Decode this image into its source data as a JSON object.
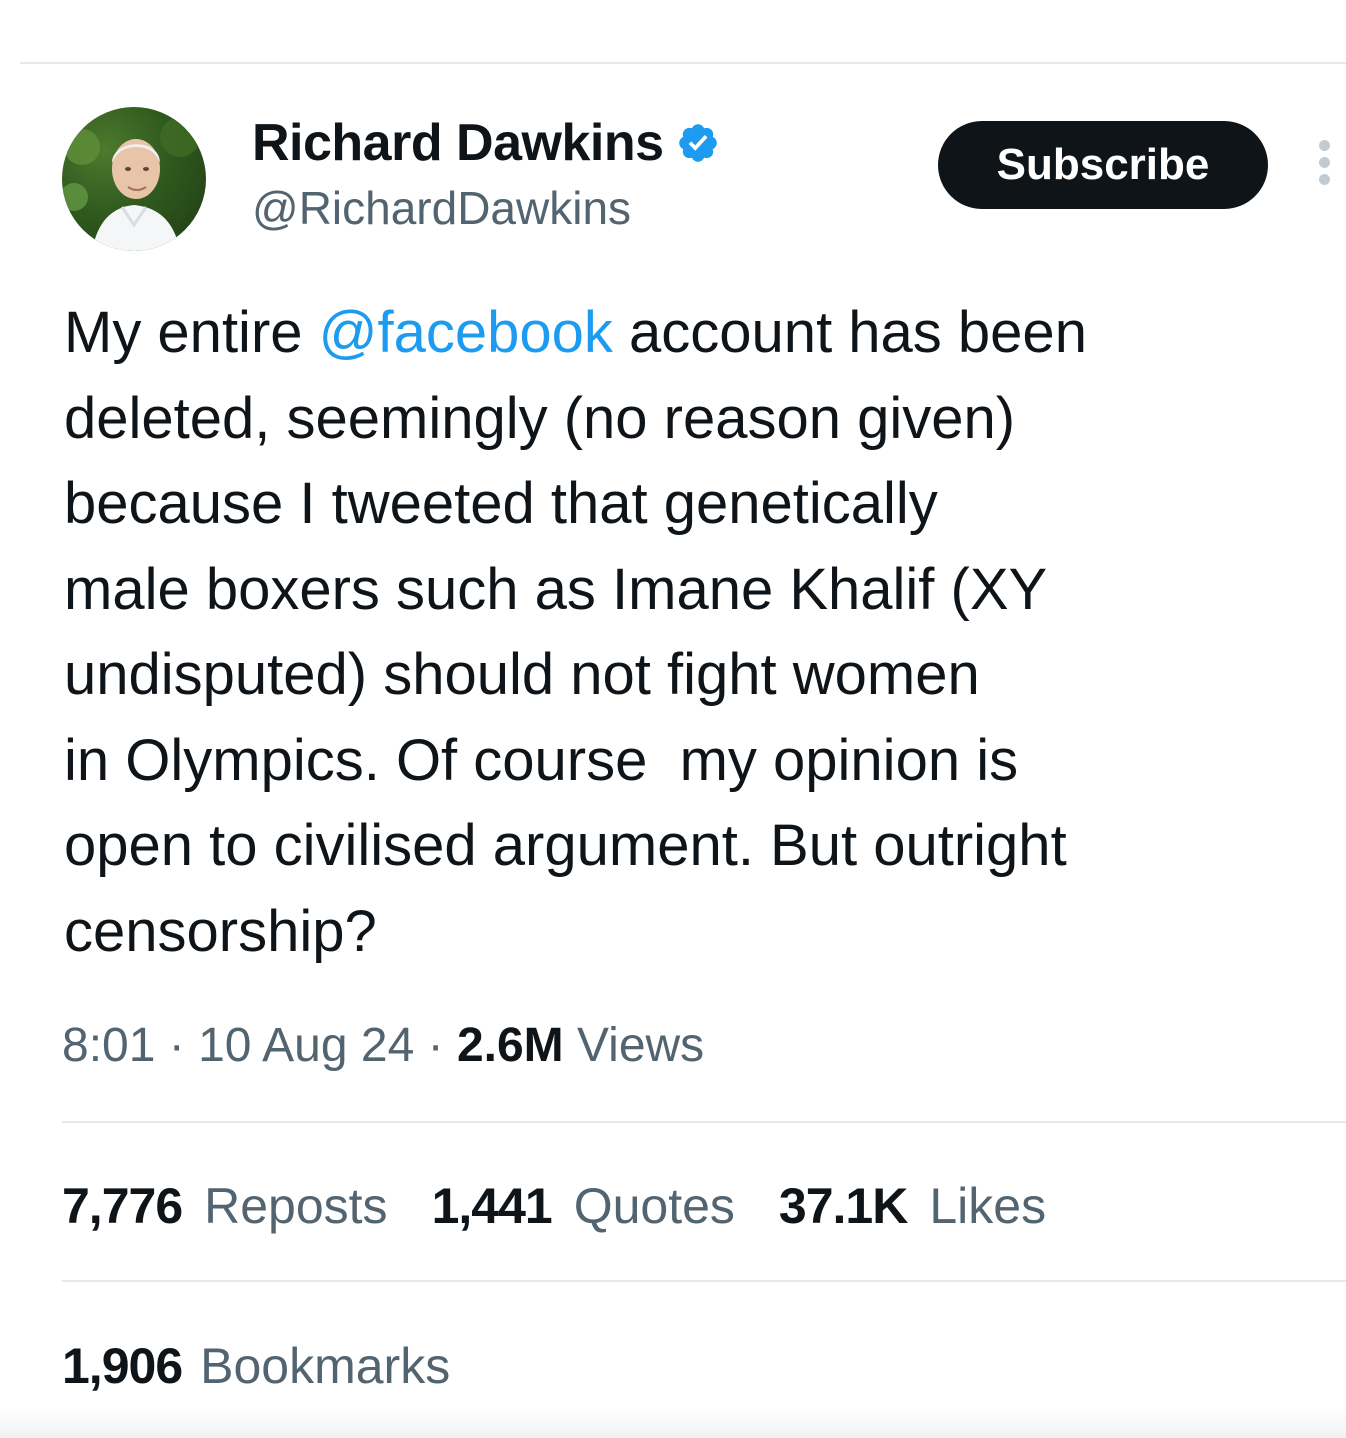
{
  "author": {
    "display_name": "Richard Dawkins",
    "handle": "@RichardDawkins",
    "verified": true,
    "verified_color": "#1d9bf0",
    "avatar_icon": "profile-photo"
  },
  "actions": {
    "subscribe_label": "Subscribe",
    "more_icon": "vertical-ellipsis-icon"
  },
  "tweet": {
    "text_before_mention": "My entire ",
    "mention": "@facebook",
    "text_after_mention": " account has been\ndeleted, seemingly (no reason given)\nbecause I tweeted that genetically\nmale boxers such as Imane Khalif (XY\nundisputed) should not fight women\nin Olympics. Of course  my opinion is\nopen to civilised argument. But outright\ncensorship?",
    "mention_color": "#1d9bf0"
  },
  "meta": {
    "time": "8:01",
    "separator": " · ",
    "date": "10 Aug 24",
    "views_count": "2.6M",
    "views_label": " Views"
  },
  "stats": {
    "reposts_count": "7,776",
    "reposts_label": "Reposts",
    "quotes_count": "1,441",
    "quotes_label": "Quotes",
    "likes_count": "37.1K",
    "likes_label": "Likes",
    "bookmarks_count": "1,906",
    "bookmarks_label": "Bookmarks"
  }
}
